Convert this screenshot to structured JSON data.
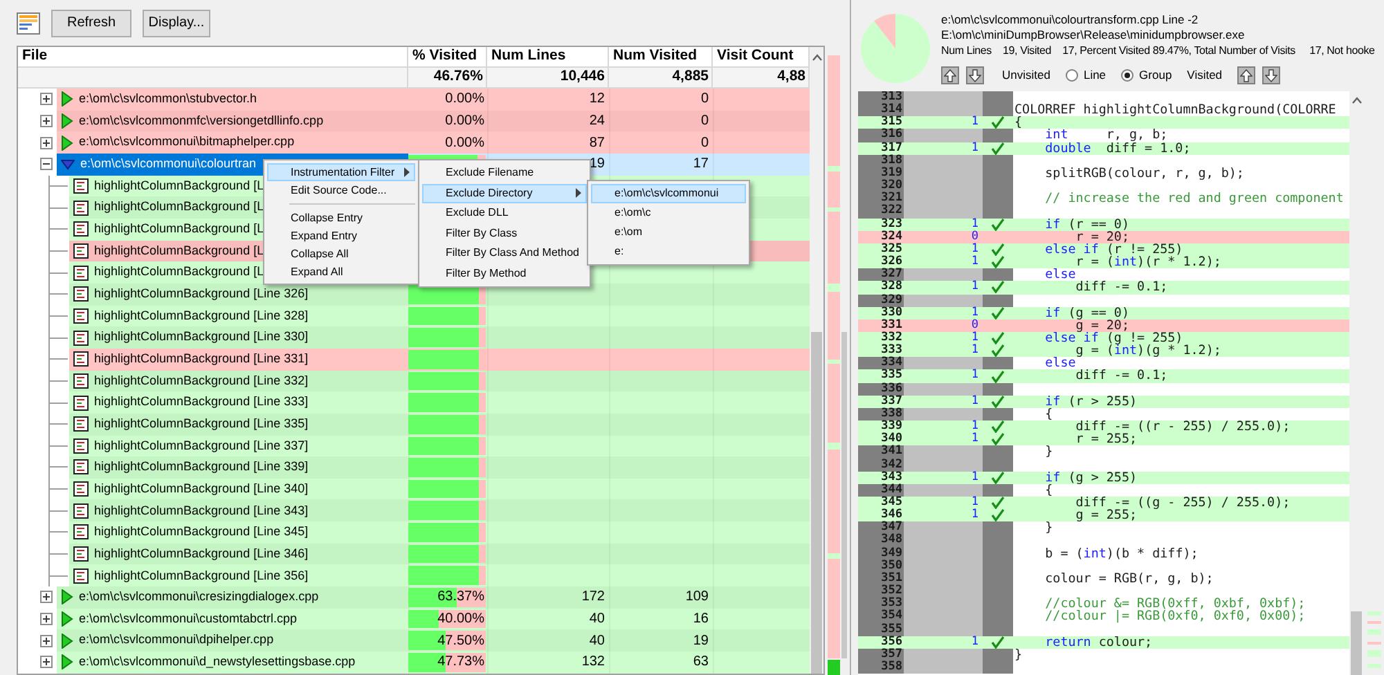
{
  "toolbar": {
    "buttons": [
      "Refresh",
      "Display..."
    ]
  },
  "table": {
    "columns": [
      "File",
      "% Visited",
      "Num Lines",
      "Num Visited",
      "Visit Count"
    ],
    "totals": {
      "percent_visited": "46.76%",
      "num_lines": "10,446",
      "num_visited": "4,885",
      "visit_count": "4,88"
    },
    "files": [
      {
        "path": "e:\\om\\c\\svlcommon\\stubvector.h",
        "percent_visited": "0.00%",
        "num_lines": "12",
        "num_visited": "0",
        "visited": false,
        "expanded": false,
        "selected": false
      },
      {
        "path": "e:\\om\\c\\svlcommonmfc\\versiongetdllinfo.cpp",
        "percent_visited": "0.00%",
        "num_lines": "24",
        "num_visited": "0",
        "visited": false,
        "expanded": false,
        "selected": false
      },
      {
        "path": "e:\\om\\c\\svlcommonui\\bitmaphelper.cpp",
        "percent_visited": "0.00%",
        "num_lines": "87",
        "num_visited": "0",
        "visited": false,
        "expanded": false,
        "selected": false
      },
      {
        "path": "e:\\om\\c\\svlcommonui\\colourtran",
        "level": 0.89,
        "num_lines": "19",
        "num_visited": "17",
        "visited": true,
        "expanded": true,
        "selected": true,
        "children": [
          {
            "label": "highlightColumnBackground [L",
            "visited": true
          },
          {
            "label": "highlightColumnBackground [L",
            "visited": true
          },
          {
            "label": "highlightColumnBackground [L",
            "visited": true
          },
          {
            "label": "highlightColumnBackground [L",
            "visited": false
          },
          {
            "label": "highlightColumnBackground [L",
            "visited": true
          },
          {
            "label": "highlightColumnBackground [Line 326]",
            "visited": true,
            "level": 0.91
          },
          {
            "label": "highlightColumnBackground [Line 328]",
            "visited": true,
            "level": 0.91
          },
          {
            "label": "highlightColumnBackground [Line 330]",
            "visited": true,
            "level": 0.91
          },
          {
            "label": "highlightColumnBackground [Line 331]",
            "visited": false,
            "level": 0.91
          },
          {
            "label": "highlightColumnBackground [Line 332]",
            "visited": true,
            "level": 0.91
          },
          {
            "label": "highlightColumnBackground [Line 333]",
            "visited": true,
            "level": 0.91
          },
          {
            "label": "highlightColumnBackground [Line 335]",
            "visited": true,
            "level": 0.91
          },
          {
            "label": "highlightColumnBackground [Line 337]",
            "visited": true,
            "level": 0.91
          },
          {
            "label": "highlightColumnBackground [Line 339]",
            "visited": true,
            "level": 0.91
          },
          {
            "label": "highlightColumnBackground [Line 340]",
            "visited": true,
            "level": 0.91
          },
          {
            "label": "highlightColumnBackground [Line 343]",
            "visited": true,
            "level": 0.91
          },
          {
            "label": "highlightColumnBackground [Line 345]",
            "visited": true,
            "level": 0.91
          },
          {
            "label": "highlightColumnBackground [Line 346]",
            "visited": true,
            "level": 0.91
          },
          {
            "label": "highlightColumnBackground [Line 356]",
            "visited": true,
            "level": 0.91
          }
        ]
      },
      {
        "path": "e:\\om\\c\\svlcommonui\\cresizingdialogex.cpp",
        "percent_visited": "63.37%",
        "level": 0.6337,
        "num_lines": "172",
        "num_visited": "109",
        "visited": true,
        "expanded": false,
        "selected": false
      },
      {
        "path": "e:\\om\\c\\svlcommonui\\customtabctrl.cpp",
        "percent_visited": "40.00%",
        "level": 0.4,
        "num_lines": "40",
        "num_visited": "16",
        "visited": true,
        "expanded": false,
        "selected": false
      },
      {
        "path": "e:\\om\\c\\svlcommonui\\dpihelper.cpp",
        "percent_visited": "47.50%",
        "level": 0.475,
        "num_lines": "40",
        "num_visited": "19",
        "visited": true,
        "expanded": false,
        "selected": false
      },
      {
        "path": "e:\\om\\c\\svlcommonui\\d_newstylesettingsbase.cpp",
        "percent_visited": "47.73%",
        "level": 0.4773,
        "num_lines": "132",
        "num_visited": "63",
        "visited": true,
        "expanded": false,
        "selected": false
      }
    ]
  },
  "context_menus": [
    {
      "items": [
        {
          "label": "Instrumentation Filter",
          "kind": "item",
          "submenu": true,
          "selected": true
        },
        {
          "label": "Edit Source Code...",
          "kind": "item",
          "submenu": false,
          "selected": false
        },
        {
          "kind": "separator"
        },
        {
          "label": "Collapse Entry",
          "kind": "item",
          "submenu": false,
          "selected": false
        },
        {
          "label": "Expand Entry",
          "kind": "item",
          "submenu": false,
          "selected": false
        },
        {
          "label": "Collapse All",
          "kind": "item",
          "submenu": false,
          "selected": false
        },
        {
          "label": "Expand All",
          "kind": "item",
          "submenu": false,
          "selected": false
        }
      ]
    },
    {
      "items": [
        {
          "label": "Exclude Filename",
          "kind": "item",
          "submenu": false,
          "selected": false
        },
        {
          "label": "Exclude Directory",
          "kind": "item",
          "submenu": true,
          "selected": true
        },
        {
          "label": "Exclude DLL",
          "kind": "item",
          "submenu": false,
          "selected": false
        },
        {
          "label": "Filter By Class",
          "kind": "item",
          "submenu": false,
          "selected": false
        },
        {
          "label": "Filter By Class And Method",
          "kind": "item",
          "submenu": false,
          "selected": false
        },
        {
          "label": "Filter By Method",
          "kind": "item",
          "submenu": false,
          "selected": false
        }
      ]
    },
    {
      "items": [
        {
          "label": "e:\\om\\c\\svlcommonui",
          "kind": "item",
          "submenu": false,
          "selected": true
        },
        {
          "label": "e:\\om\\c",
          "kind": "item",
          "submenu": false,
          "selected": false
        },
        {
          "label": "e:\\om",
          "kind": "item",
          "submenu": false,
          "selected": false
        },
        {
          "label": "e:",
          "kind": "item",
          "submenu": false,
          "selected": false
        }
      ]
    }
  ],
  "source_panel": {
    "file_line": "e:\\om\\c\\svlcommonui\\colourtransform.cpp Line -2",
    "exe_path": "E:\\om\\c\\miniDumpBrowser\\Release\\minidumpbrowser.exe",
    "stats": "Num Lines    19, Visited    17, Percent Visited 89.47%, Total Number of Visits     17, Not hooke",
    "legend_unvisited": "Unvisited",
    "legend_visited": "Visited",
    "radios": [
      {
        "label": "Line",
        "selected": false
      },
      {
        "label": "Group",
        "selected": true
      }
    ],
    "lines": [
      {
        "number": "313",
        "kind": "plain"
      },
      {
        "number": "314",
        "kind": "plain",
        "code": [
          {
            "text": "COLORREF highlightColumnBackground(COLORRE"
          }
        ]
      },
      {
        "number": "315",
        "kind": "visited",
        "count": "1",
        "code": [
          {
            "text": "{"
          }
        ]
      },
      {
        "number": "316",
        "kind": "plain",
        "code": [
          {
            "text": "    int",
            "kind": "keyword"
          },
          {
            "text": "     r, g, b;"
          }
        ]
      },
      {
        "number": "317",
        "kind": "visited",
        "count": "1",
        "code": [
          {
            "text": "    double",
            "kind": "keyword"
          },
          {
            "text": "  diff = 1.0;"
          }
        ]
      },
      {
        "number": "318",
        "kind": "plain"
      },
      {
        "number": "319",
        "kind": "plain",
        "code": [
          {
            "text": "    splitRGB(colour, r, g, b);"
          }
        ]
      },
      {
        "number": "320",
        "kind": "plain"
      },
      {
        "number": "321",
        "kind": "plain",
        "code": [
          {
            "text": "    // increase the red and green component",
            "kind": "comment"
          }
        ]
      },
      {
        "number": "322",
        "kind": "plain"
      },
      {
        "number": "323",
        "kind": "visited",
        "count": "1",
        "code": [
          {
            "text": "    if",
            "kind": "keyword"
          },
          {
            "text": " (r == 0)"
          }
        ]
      },
      {
        "number": "324",
        "kind": "unvisited",
        "count": "0",
        "code": [
          {
            "text": "        r = 20;"
          }
        ]
      },
      {
        "number": "325",
        "kind": "visited",
        "count": "1",
        "code": [
          {
            "text": "    else if",
            "kind": "keyword"
          },
          {
            "text": " (r != 255)"
          }
        ]
      },
      {
        "number": "326",
        "kind": "visited",
        "count": "1",
        "code": [
          {
            "text": "        r = ("
          },
          {
            "text": "int",
            "kind": "keyword"
          },
          {
            "text": ")(r * 1.2);"
          }
        ]
      },
      {
        "number": "327",
        "kind": "plain",
        "code": [
          {
            "text": "    else",
            "kind": "keyword"
          }
        ]
      },
      {
        "number": "328",
        "kind": "visited",
        "count": "1",
        "code": [
          {
            "text": "        diff -= 0.1;"
          }
        ]
      },
      {
        "number": "329",
        "kind": "plain"
      },
      {
        "number": "330",
        "kind": "visited",
        "count": "1",
        "code": [
          {
            "text": "    if",
            "kind": "keyword"
          },
          {
            "text": " (g == 0)"
          }
        ]
      },
      {
        "number": "331",
        "kind": "unvisited",
        "count": "0",
        "code": [
          {
            "text": "        g = 20;"
          }
        ]
      },
      {
        "number": "332",
        "kind": "visited",
        "count": "1",
        "code": [
          {
            "text": "    else if",
            "kind": "keyword"
          },
          {
            "text": " (g != 255)"
          }
        ]
      },
      {
        "number": "333",
        "kind": "visited",
        "count": "1",
        "code": [
          {
            "text": "        g = ("
          },
          {
            "text": "int",
            "kind": "keyword"
          },
          {
            "text": ")(g * 1.2);"
          }
        ]
      },
      {
        "number": "334",
        "kind": "plain",
        "code": [
          {
            "text": "    else",
            "kind": "keyword"
          }
        ]
      },
      {
        "number": "335",
        "kind": "visited",
        "count": "1",
        "code": [
          {
            "text": "        diff -= 0.1;"
          }
        ]
      },
      {
        "number": "336",
        "kind": "plain"
      },
      {
        "number": "337",
        "kind": "visited",
        "count": "1",
        "code": [
          {
            "text": "    if",
            "kind": "keyword"
          },
          {
            "text": " (r > 255)"
          }
        ]
      },
      {
        "number": "338",
        "kind": "plain",
        "code": [
          {
            "text": "    {"
          }
        ]
      },
      {
        "number": "339",
        "kind": "visited",
        "count": "1",
        "code": [
          {
            "text": "        diff -= ((r - 255) / 255.0);"
          }
        ]
      },
      {
        "number": "340",
        "kind": "visited",
        "count": "1",
        "code": [
          {
            "text": "        r = 255;"
          }
        ]
      },
      {
        "number": "341",
        "kind": "plain",
        "code": [
          {
            "text": "    }"
          }
        ]
      },
      {
        "number": "342",
        "kind": "plain"
      },
      {
        "number": "343",
        "kind": "visited",
        "count": "1",
        "code": [
          {
            "text": "    if",
            "kind": "keyword"
          },
          {
            "text": " (g > 255)"
          }
        ]
      },
      {
        "number": "344",
        "kind": "plain",
        "code": [
          {
            "text": "    {"
          }
        ]
      },
      {
        "number": "345",
        "kind": "visited",
        "count": "1",
        "code": [
          {
            "text": "        diff -= ((g - 255) / 255.0);"
          }
        ]
      },
      {
        "number": "346",
        "kind": "visited",
        "count": "1",
        "code": [
          {
            "text": "        g = 255;"
          }
        ]
      },
      {
        "number": "347",
        "kind": "plain",
        "code": [
          {
            "text": "    }"
          }
        ]
      },
      {
        "number": "348",
        "kind": "plain"
      },
      {
        "number": "349",
        "kind": "plain",
        "code": [
          {
            "text": "    b = ("
          },
          {
            "text": "int",
            "kind": "keyword"
          },
          {
            "text": ")(b * diff);"
          }
        ]
      },
      {
        "number": "350",
        "kind": "plain"
      },
      {
        "number": "351",
        "kind": "plain",
        "code": [
          {
            "text": "    colour = RGB(r, g, b);"
          }
        ]
      },
      {
        "number": "352",
        "kind": "plain"
      },
      {
        "number": "353",
        "kind": "plain",
        "code": [
          {
            "text": "    //colour &= RGB(0xff, 0xbf, 0xbf);",
            "kind": "comment"
          }
        ]
      },
      {
        "number": "354",
        "kind": "plain",
        "code": [
          {
            "text": "    //colour |= RGB(0xf0, 0xf0, 0x00);",
            "kind": "comment"
          }
        ]
      },
      {
        "number": "355",
        "kind": "plain"
      },
      {
        "number": "356",
        "kind": "visited",
        "count": "1",
        "code": [
          {
            "text": "    return",
            "kind": "keyword"
          },
          {
            "text": " colour;"
          }
        ]
      },
      {
        "number": "357",
        "kind": "plain",
        "code": [
          {
            "text": "}"
          }
        ]
      },
      {
        "number": "358",
        "kind": "plain"
      }
    ]
  }
}
